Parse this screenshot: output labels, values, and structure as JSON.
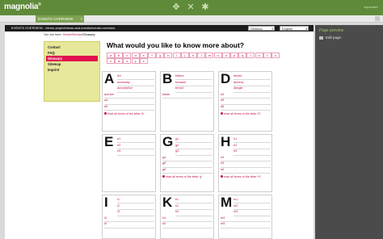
{
  "topbar": {
    "logo": "magnolia",
    "logo_sup": "®",
    "user": "superuser",
    "icons": [
      "apps-icon",
      "pulse-icon",
      "favorites-icon"
    ]
  },
  "tabs": [
    {
      "label": "EVENTS OVERVIEW",
      "close": "×"
    }
  ],
  "toolbar": {
    "path": "EVENTS OVERVIEW - /demo-project/news-and-events/events-overview",
    "view": "Desktop",
    "language": "English"
  },
  "breadcrumb": {
    "prefix": "You are here:",
    "items": [
      "Home",
      "Service"
    ],
    "separator": "/",
    "current": "Glossary"
  },
  "menu": [
    {
      "label": "Contact",
      "active": false
    },
    {
      "label": "FAQ",
      "active": false
    },
    {
      "label": "Glossary",
      "active": true
    },
    {
      "label": "Sitemap",
      "active": false
    },
    {
      "label": "Imprint",
      "active": false
    }
  ],
  "heading": "What would you like to know more about?",
  "letters_row1": [
    "a",
    "b",
    "c",
    "d",
    "e",
    "f",
    "g",
    "h",
    "i",
    "j",
    "k",
    "l",
    "m",
    "n",
    "o",
    "p",
    "q",
    "r",
    "s",
    "t",
    "u"
  ],
  "letters_row2": [
    "v",
    "w",
    "x",
    "y",
    "z"
  ],
  "cards": [
    {
      "letter": "A",
      "terms": [
        "Art",
        "accessity",
        "accomplice",
        "ach'lee",
        "a4",
        "a5"
      ],
      "readall": "read all terms of the letter 'A'"
    },
    {
      "letter": "B",
      "terms": [
        "bitters",
        "browser",
        "bread",
        "baste"
      ],
      "readall": ""
    },
    {
      "letter": "D",
      "terms": [
        "desire",
        "dummy",
        "dangle",
        "d4",
        "d5",
        "d6"
      ],
      "readall": "read all terms of the letter 'D'"
    },
    {
      "letter": "E",
      "terms": [
        "e1",
        "e2",
        "e3"
      ],
      "readall": ""
    },
    {
      "letter": "G",
      "terms": [
        "g1",
        "g2",
        "g3",
        "g4",
        "g5",
        "g6"
      ],
      "readall": "read all terms of the letter 'g'"
    },
    {
      "letter": "H",
      "terms": [
        "h1",
        "h2",
        "h3",
        "h4",
        "h5",
        "h6"
      ],
      "readall": "read all terms of the letter 'H'"
    },
    {
      "letter": "I",
      "terms": [
        "i1",
        "i2",
        "i3",
        "i4",
        "i5"
      ],
      "readall": ""
    },
    {
      "letter": "K",
      "terms": [
        "k1",
        "k2",
        "k3",
        "k4",
        "k5"
      ],
      "readall": ""
    },
    {
      "letter": "M",
      "terms": [
        "m1",
        "m2",
        "m3",
        "m4",
        "m5"
      ],
      "readall": ""
    }
  ],
  "right_panel": {
    "title": "Page preview",
    "items": [
      {
        "label": "Edit page",
        "icon": "edit-page-icon"
      }
    ]
  },
  "colors": {
    "topbar": "#5f8a3a",
    "accent": "#e0124f",
    "link": "#c0124a",
    "menu_bg": "#e8e89a",
    "panel": "#4b4b4b"
  }
}
